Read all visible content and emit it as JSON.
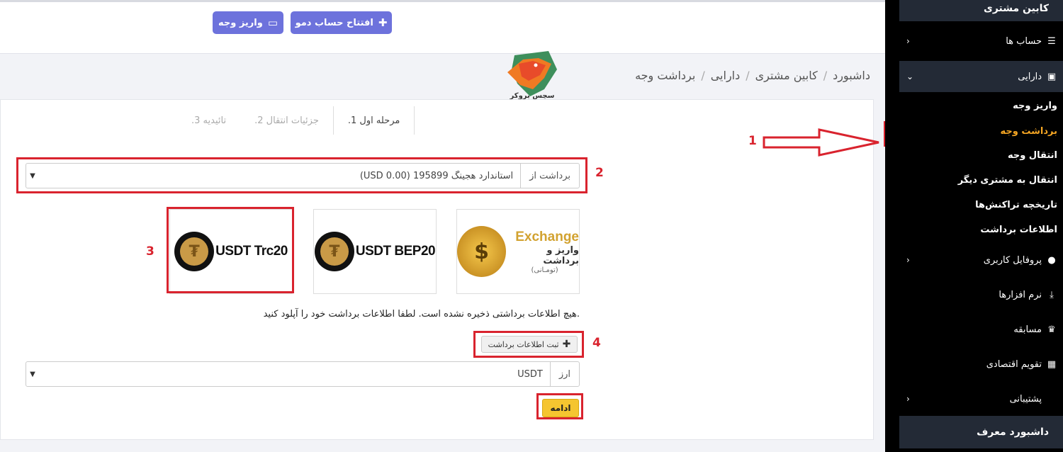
{
  "topbar": {
    "demo_button": "افتتاح حساب دمو",
    "deposit_button": "واریز وجه"
  },
  "breadcrumb": [
    "داشبورد",
    "کابین مشتری",
    "دارایی",
    "برداشت وجه"
  ],
  "logo": {
    "text": "سچس بروکر"
  },
  "steps": [
    "مرحله اول 1.",
    "جزئیات انتقال 2.",
    "تائیدیه 3."
  ],
  "withdraw_from": {
    "label": "برداشت از",
    "value": "استاندارد هجینگ 195899 (USD 0.00)"
  },
  "methods": [
    {
      "name": "exchange",
      "title": "Exchange",
      "sub1": "واریز و برداشت",
      "sub2": "(تومـانی)"
    },
    {
      "name": "usdt-bep20",
      "label": "USDT BEP20"
    },
    {
      "name": "usdt-trc20",
      "label": "USDT Trc20"
    }
  ],
  "notice": ".هیچ اطلاعات برداشتی ذخیره نشده است. لطفا اطلاعات برداشت خود را آپلود کنید",
  "add_info_button": "ثبت اطلاعات برداشت",
  "currency": {
    "label": "ارز",
    "value": "USDT"
  },
  "continue_button": "ادامه",
  "annotations": [
    "1",
    "2",
    "3",
    "4"
  ],
  "sidebar": {
    "header": "کابین مشتری",
    "accounts": "حساب ها",
    "assets": "دارایی",
    "sub_items": [
      "واریز وجه",
      "برداشت وجه",
      "انتقال وجه",
      "انتقال به مشتری دیگر",
      "تاریخچه تراکنش‌ها",
      "اطلاعات برداشت"
    ],
    "profile": "پروفایل کاربری",
    "software": "نرم افزارها",
    "contest": "مسابقه",
    "calendar": "تقویم اقتصادی",
    "support": "پشتیبانی",
    "referrer": "داشبورد معرف"
  },
  "colors": {
    "accent": "#6d72dc",
    "highlight": "#d9232e",
    "active_menu": "#f5a623",
    "continue": "#f5c530"
  }
}
